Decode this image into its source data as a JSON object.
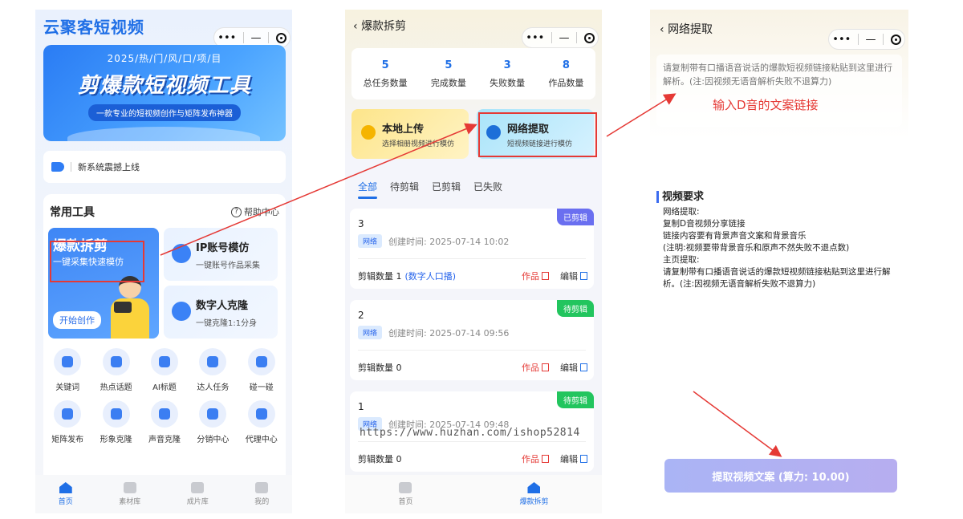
{
  "phone1": {
    "app_title": "云聚客短视频",
    "banner": {
      "year_line": "2025/热/门/风/口/项/目",
      "main": "剪爆款短视频工具",
      "sub": "一款专业的短视频创作与矩阵发布神器"
    },
    "notice": "新系统震撼上线",
    "tools_title": "常用工具",
    "help": "帮助中心",
    "feature_main": {
      "title": "爆款拆剪",
      "sub": "一键采集快速模仿",
      "button": "开始创作"
    },
    "feature_ip": {
      "title": "IP账号模仿",
      "sub": "一键账号作品采集"
    },
    "feature_digital": {
      "title": "数字人克隆",
      "sub": "一键克隆1:1分身"
    },
    "grid": [
      "关键词",
      "热点话题",
      "AI标题",
      "达人任务",
      "碰一碰",
      "矩阵发布",
      "形象克隆",
      "声音克隆",
      "分销中心",
      "代理中心"
    ],
    "tabs": [
      "首页",
      "素材库",
      "成片库",
      "我的"
    ]
  },
  "phone2": {
    "nav_title": "爆款拆剪",
    "stats": [
      {
        "num": "5",
        "label": "总任务数量"
      },
      {
        "num": "5",
        "label": "完成数量"
      },
      {
        "num": "3",
        "label": "失败数量"
      },
      {
        "num": "8",
        "label": "作品数量"
      }
    ],
    "local_upload": {
      "title": "本地上传",
      "sub": "选择相册视频进行模仿"
    },
    "network_extract": {
      "title": "网络提取",
      "sub": "短视频链接进行模仿"
    },
    "filter_tabs": [
      "全部",
      "待剪辑",
      "已剪辑",
      "已失败"
    ],
    "tasks": [
      {
        "id": "3",
        "badge": "已剪辑",
        "tag": "网络",
        "time": "创建时间: 2025-07-14 10:02",
        "count": "剪辑数量 1",
        "extra": "(数字人口播)",
        "work": "作品",
        "edit": "编辑"
      },
      {
        "id": "2",
        "badge": "待剪辑",
        "tag": "网络",
        "time": "创建时间: 2025-07-14 09:56",
        "count": "剪辑数量 0",
        "extra": "",
        "work": "作品",
        "edit": "编辑"
      },
      {
        "id": "1",
        "badge": "待剪辑",
        "tag": "网络",
        "time": "创建时间: 2025-07-14 09:48",
        "count": "剪辑数量 0",
        "extra": "",
        "work": "作品",
        "edit": "编辑"
      }
    ],
    "watermark": "https://www.huzhan.com/ishop52814",
    "tabs": [
      "首页",
      "爆款拆剪"
    ]
  },
  "phone3": {
    "nav_title": "网络提取",
    "placeholder": "请复制带有口播语音说话的爆款短视频链接粘贴到这里进行解析。(注:因视频无语音解析失败不退算力)",
    "annotation": "输入D音的文案链接",
    "req_title": "视频要求",
    "req_lines": [
      "网络提取:",
      "复制D音视频分享链接",
      "链接内容要有背景声音文案和背景音乐",
      "(注明:视频要带背景音乐和原声不然失败不退点数)",
      "主页提取:",
      "请复制带有口播语音说话的爆款短视频链接粘贴到这里进行解析。(注:因视频无语音解析失败不退算力)"
    ],
    "submit": "提取视频文案 (算力: 10.00)"
  },
  "colors": {
    "primary": "#1f6fe6",
    "annotation_red": "#e53935",
    "done_badge": "#6a6ff0",
    "pending_badge": "#22c55e"
  }
}
